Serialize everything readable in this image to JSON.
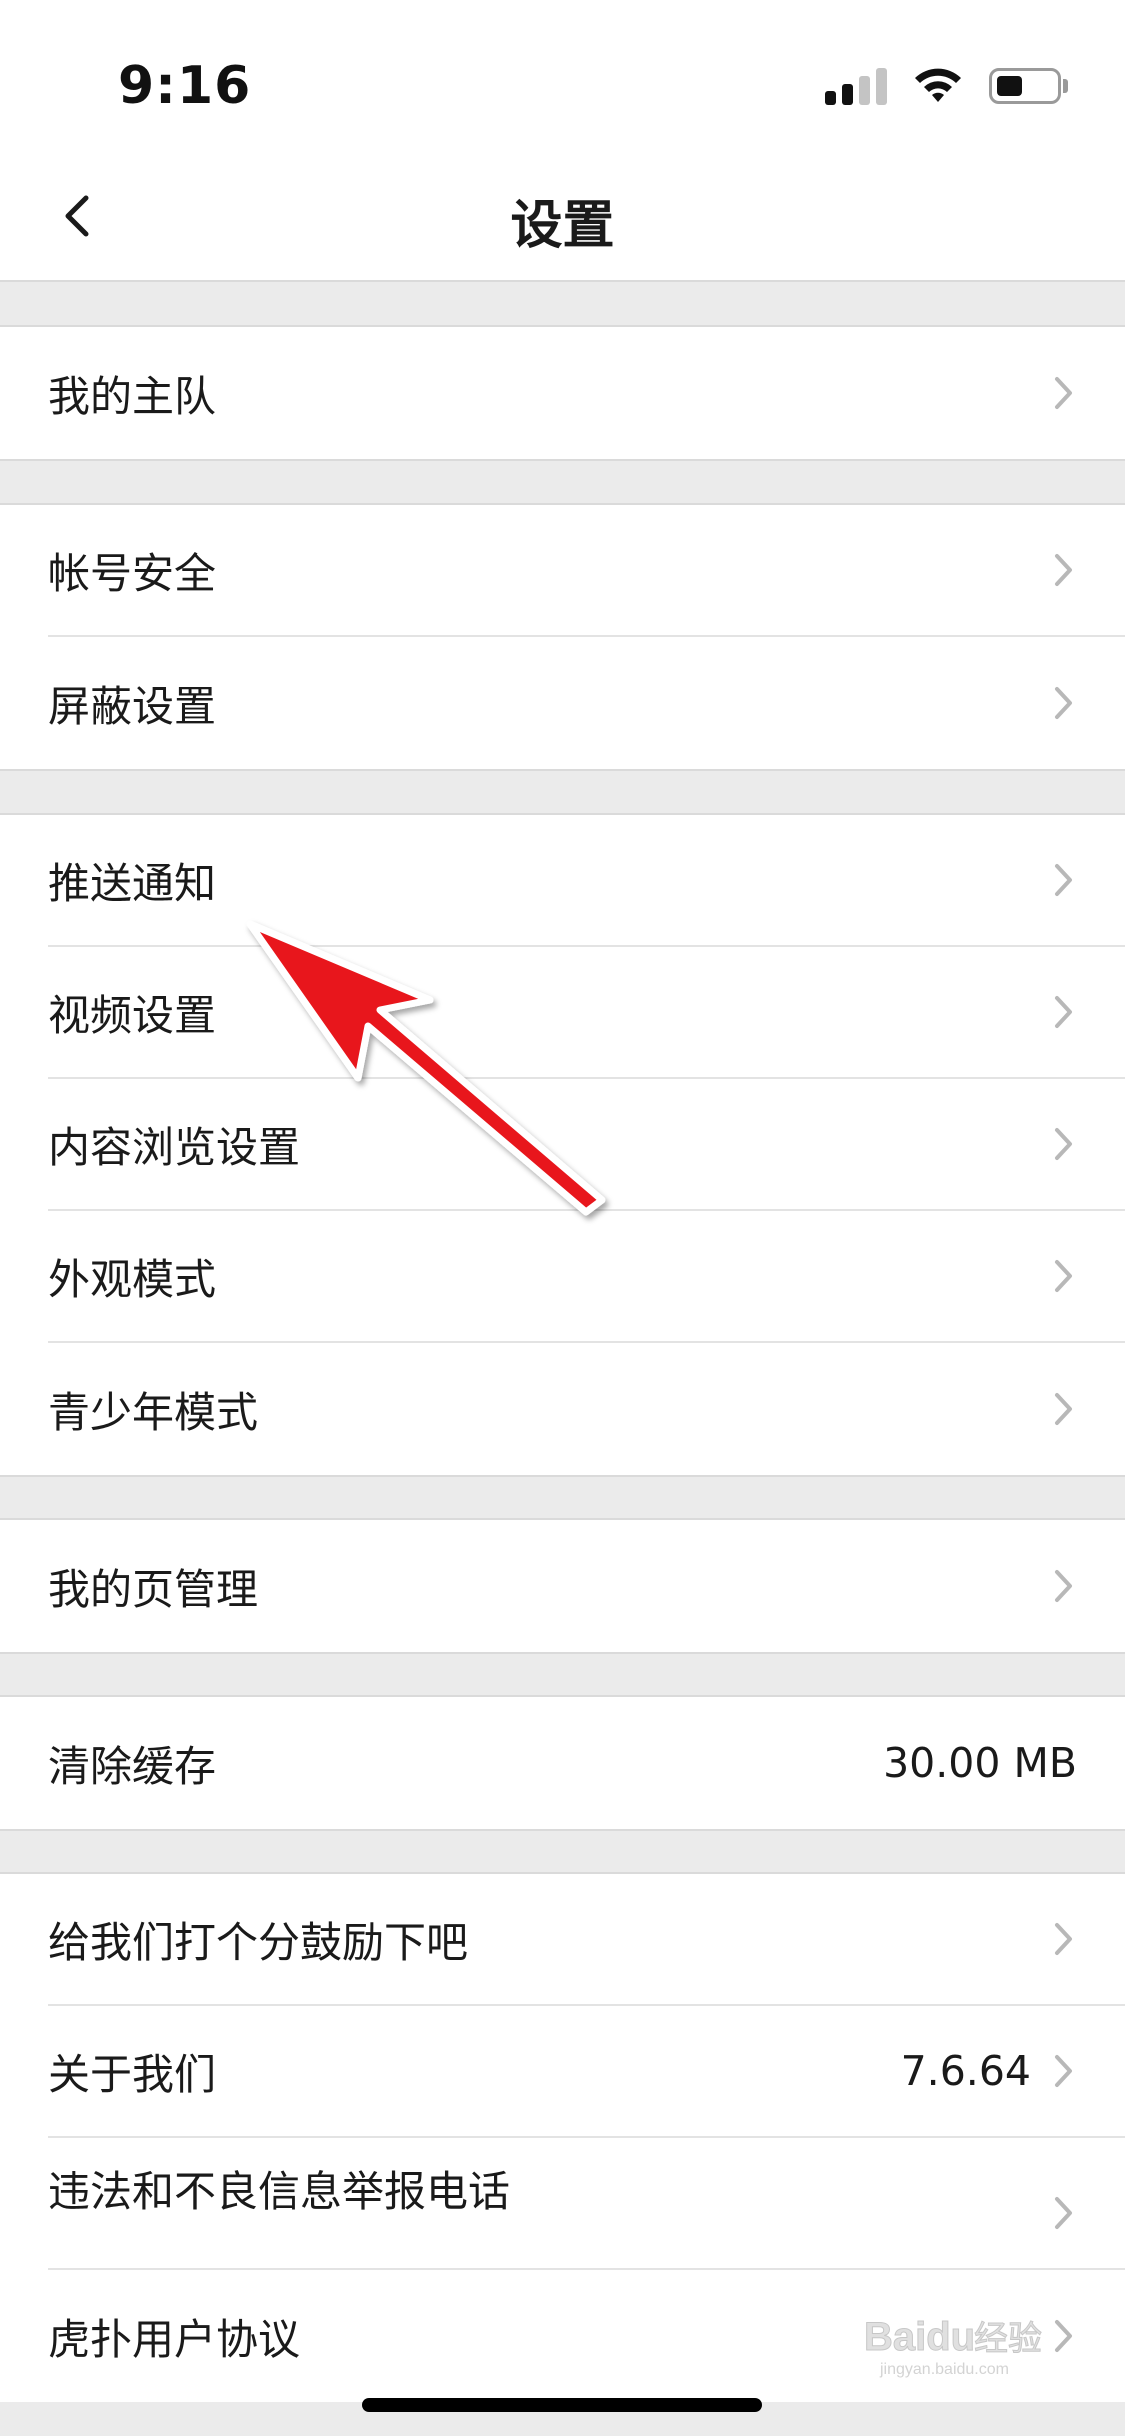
{
  "status_bar": {
    "time": "9:16",
    "signal_bars": 4,
    "signal_bars_active": 2,
    "battery_level": 0.45,
    "icons": [
      "signal-icon",
      "wifi-icon",
      "battery-icon"
    ]
  },
  "nav": {
    "back_icon": "chevron-left-icon",
    "title": "设置"
  },
  "sections": [
    {
      "items": [
        {
          "label": "我的主队",
          "chevron": true
        }
      ]
    },
    {
      "items": [
        {
          "label": "帐号安全",
          "chevron": true
        },
        {
          "label": "屏蔽设置",
          "chevron": true
        }
      ]
    },
    {
      "items": [
        {
          "label": "推送通知",
          "chevron": true
        },
        {
          "label": "视频设置",
          "chevron": true
        },
        {
          "label": "内容浏览设置",
          "chevron": true
        },
        {
          "label": "外观模式",
          "chevron": true
        },
        {
          "label": "青少年模式",
          "chevron": true
        }
      ]
    },
    {
      "items": [
        {
          "label": "我的页管理",
          "chevron": true
        }
      ]
    },
    {
      "items": [
        {
          "label": "清除缓存",
          "value": "30.00 MB",
          "chevron": false
        }
      ]
    },
    {
      "items": [
        {
          "label": "给我们打个分鼓励下吧",
          "chevron": true
        },
        {
          "label": "关于我们",
          "value": "7.6.64",
          "chevron": true
        },
        {
          "label": "违法和不良信息举报电话",
          "chevron": true
        },
        {
          "label": "虎扑用户协议",
          "chevron": true
        }
      ]
    }
  ],
  "annotation": {
    "color": "#e8141c",
    "points_to": "推送通知"
  },
  "watermark": {
    "text": "Baidu经验",
    "sub": "jingyan.baidu.com"
  }
}
